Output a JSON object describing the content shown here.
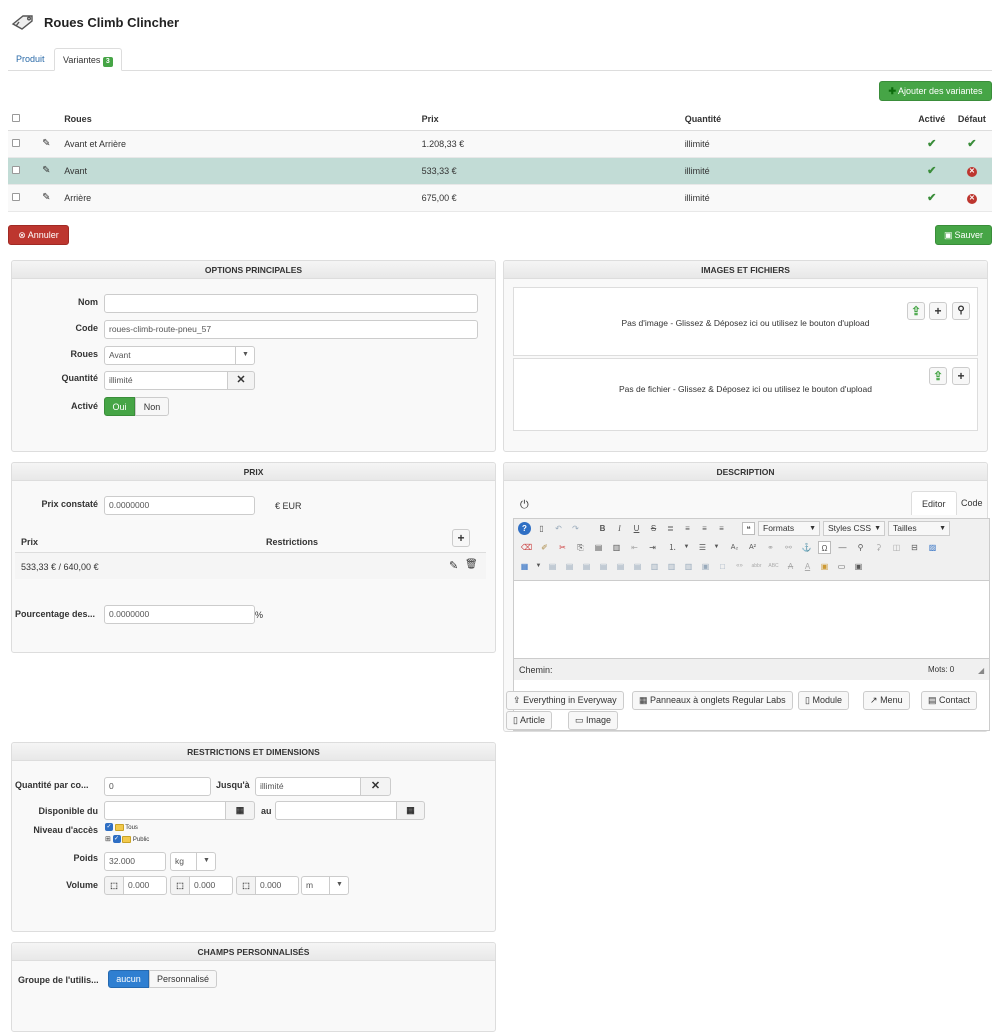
{
  "header": {
    "title": "Roues Climb Clincher",
    "icon": "tag-icon"
  },
  "tabs": [
    {
      "label": "Produit"
    },
    {
      "label": "Variantes",
      "badge": "3"
    }
  ],
  "add_variants_label": "Ajouter des variantes",
  "variants_table": {
    "headers": [
      "Roues",
      "Prix",
      "Quantité",
      "Activé",
      "Défaut"
    ],
    "rows": [
      {
        "roues": "Avant et Arrière",
        "prix": "1.208,33 €",
        "quantite": "illimité",
        "active": true,
        "default": true
      },
      {
        "roues": "Avant",
        "prix": "533,33 €",
        "quantite": "illimité",
        "active": true,
        "default": false
      },
      {
        "roues": "Arrière",
        "prix": "675,00 €",
        "quantite": "illimité",
        "active": true,
        "default": false
      }
    ]
  },
  "cancel_label": "Annuler",
  "save_label": "Sauver",
  "options": {
    "title": "OPTIONS PRINCIPALES",
    "nom_label": "Nom",
    "nom_value": "",
    "code_label": "Code",
    "code_value": "roues-climb-route-pneu_57",
    "roues_label": "Roues",
    "roues_value": "Avant",
    "quantite_label": "Quantité",
    "quantite_value": "illimité",
    "active_label": "Activé",
    "oui": "Oui",
    "non": "Non"
  },
  "images": {
    "title": "IMAGES ET FICHIERS",
    "no_image": "Pas d'image - Glissez & Déposez ici ou utilisez le bouton d'upload",
    "no_file": "Pas de fichier - Glissez & Déposez ici ou utilisez le bouton d'upload"
  },
  "prix": {
    "title": "PRIX",
    "constate_label": "Prix constaté",
    "constate_value": "0.0000000",
    "currency": "€ EUR",
    "col_prix": "Prix",
    "col_restrictions": "Restrictions",
    "row_value": "533,33 € / 640,00 €",
    "pourcentage_label": "Pourcentage des...",
    "pourcentage_value": "0.0000000",
    "pct": "%"
  },
  "description": {
    "title": "DESCRIPTION",
    "tab_editor": "Editor",
    "tab_code": "Code",
    "formats": "Formats",
    "styles": "Styles CSS",
    "tailles": "Tailles",
    "path_label": "Chemin:",
    "words_label": "Mots:",
    "words_value": "0",
    "buttons": [
      "Everything in Everyway",
      "Panneaux à onglets Regular Labs",
      "Module",
      "Menu",
      "Contact",
      "Article",
      "Image"
    ]
  },
  "restrictions": {
    "title": "RESTRICTIONS ET DIMENSIONS",
    "qty_label": "Quantité par co...",
    "qty_value": "0",
    "until_label": "Jusqu'à",
    "until_value": "illimité",
    "dispo_label": "Disponible du",
    "au_label": "au",
    "acces_label": "Niveau d'accès",
    "acces_tous": "Tous",
    "acces_public": "Public",
    "poids_label": "Poids",
    "poids_value": "32.000",
    "poids_unit": "kg",
    "volume_label": "Volume",
    "vol1": "0.000",
    "vol2": "0.000",
    "vol3": "0.000",
    "vol_unit": "m"
  },
  "custom": {
    "title": "CHAMPS PERSONNALISÉS",
    "group_label": "Groupe de l'utilis...",
    "opt1": "aucun",
    "opt2": "Personnalisé"
  }
}
